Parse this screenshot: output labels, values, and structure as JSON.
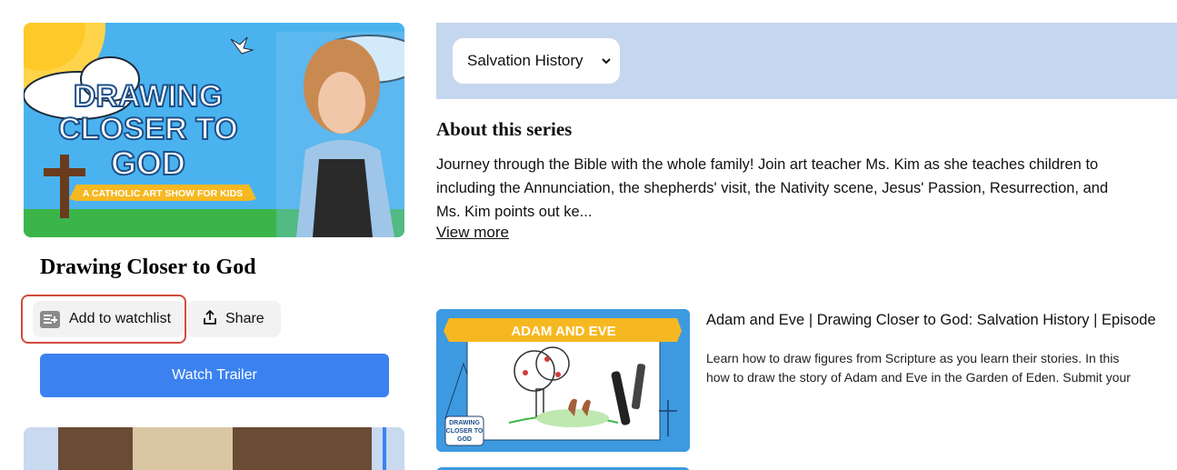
{
  "series": {
    "title": "Drawing Closer to God",
    "hero_logo_lines": [
      "DRAWING",
      "CLOSER TO",
      "GOD"
    ],
    "hero_ribbon": "A CATHOLIC ART SHOW FOR KIDS"
  },
  "actions": {
    "watchlist_label": "Add to watchlist",
    "share_label": "Share",
    "trailer_label": "Watch Trailer",
    "watchlist_icon": "playlist-add-icon",
    "share_icon": "share-icon"
  },
  "season_select": {
    "selected": "Salvation History",
    "icon": "chevron-down-icon"
  },
  "about": {
    "heading": "About this series",
    "lines": [
      "Journey through the Bible with the whole family! Join art teacher Ms. Kim as she teaches children to",
      "including the Annunciation, the shepherds' visit, the Nativity scene, Jesus' Passion, Resurrection, and",
      "Ms. Kim points out ke..."
    ],
    "view_more": "View more"
  },
  "episodes": [
    {
      "thumb_banner": "ADAM AND EVE",
      "thumb_logo_lines": [
        "DRAWING",
        "CLOSER TO",
        "GOD"
      ],
      "title": "Adam and Eve | Drawing Closer to God: Salvation History | Episode",
      "desc_lines": [
        "Learn how to draw figures from Scripture as you learn their stories. In this",
        "how to draw the story of Adam and Eve in the Garden of Eden. Submit your"
      ]
    }
  ],
  "colors": {
    "accent_blue": "#3b82f0",
    "banner_bg": "#c5d6ef",
    "highlight_red": "#d14a3c",
    "button_gray": "#f2f2f2"
  }
}
